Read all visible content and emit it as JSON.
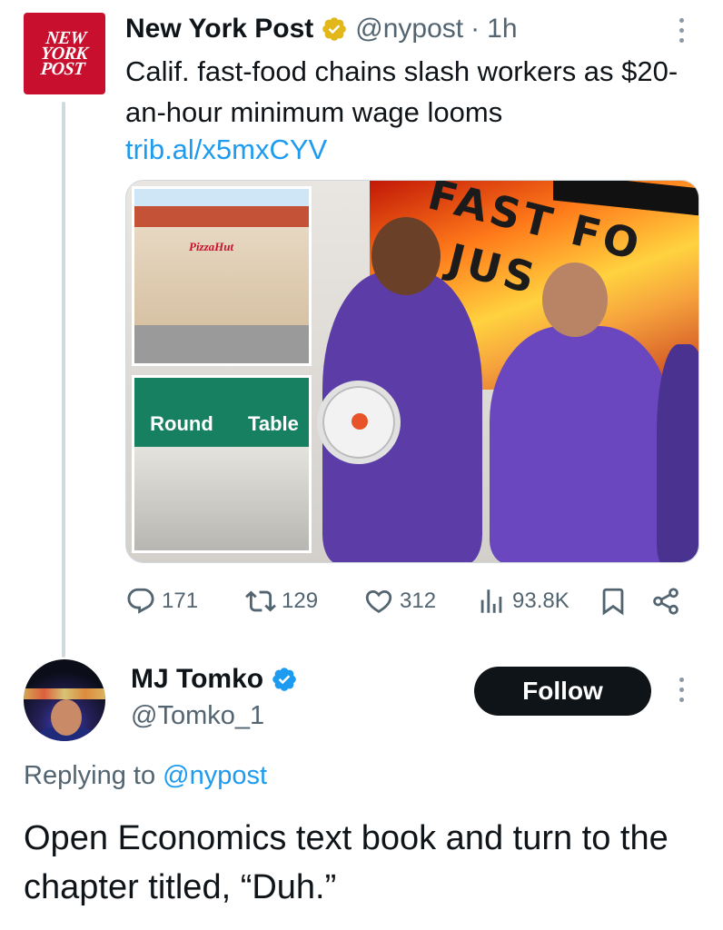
{
  "parent_tweet": {
    "avatar_logo": [
      "NEW",
      "YORK",
      "POST"
    ],
    "display_name": "New York Post",
    "handle": "@nypost",
    "separator": "·",
    "time": "1h",
    "text": "Calif. fast-food chains slash workers as $20-an-hour minimum wage looms",
    "link": "trib.al/x5mxCYV",
    "media": {
      "description_icon": "photo-collage",
      "inset_top_sign": "PizzaHut",
      "inset_bottom_sign_left": "Round",
      "inset_bottom_sign_right": "Table",
      "banner_text_line1": "FAST FO",
      "banner_text_line2": "JUS"
    },
    "actions": {
      "replies": "171",
      "retweets": "129",
      "likes": "312",
      "views": "93.8K"
    }
  },
  "reply_tweet": {
    "display_name": "MJ Tomko",
    "handle": "@Tomko_1",
    "follow_label": "Follow",
    "replying_to_prefix": "Replying to",
    "replying_to_handle": "@nypost",
    "text": "Open Economics text book and turn to the chapter titled, “Duh.”"
  },
  "colors": {
    "brand_red": "#c8102e",
    "link_blue": "#1d9bf0",
    "secondary_text": "#536471",
    "verified_gold": "#e2b719",
    "verified_blue": "#1d9bf0"
  },
  "icons": [
    "verified-gold-icon",
    "more-icon",
    "reply-icon",
    "retweet-icon",
    "like-icon",
    "views-icon",
    "bookmark-icon",
    "share-icon",
    "verified-blue-icon"
  ]
}
